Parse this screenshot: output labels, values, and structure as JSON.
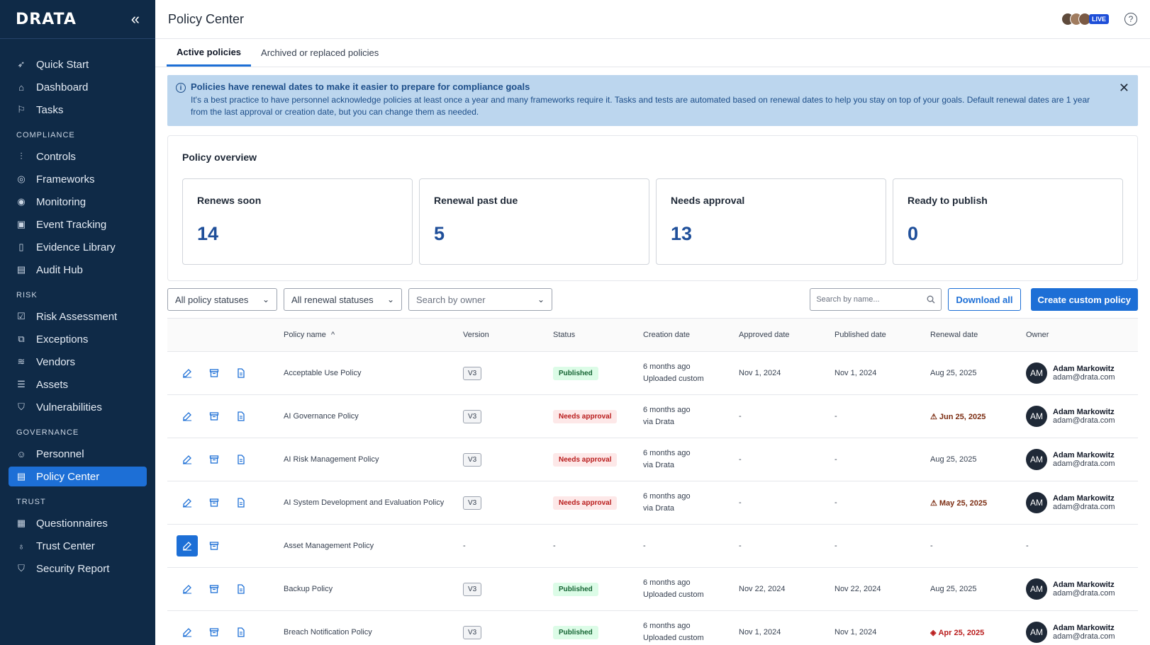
{
  "app": {
    "logo": "DRATA",
    "collapse_icon": "«"
  },
  "nav": {
    "top": [
      {
        "label": "Quick Start",
        "icon": "rocket-icon"
      },
      {
        "label": "Dashboard",
        "icon": "home-icon"
      },
      {
        "label": "Tasks",
        "icon": "flag-icon"
      }
    ],
    "sections": [
      {
        "title": "COMPLIANCE",
        "items": [
          {
            "label": "Controls"
          },
          {
            "label": "Frameworks"
          },
          {
            "label": "Monitoring"
          },
          {
            "label": "Event Tracking"
          },
          {
            "label": "Evidence Library"
          },
          {
            "label": "Audit Hub"
          }
        ]
      },
      {
        "title": "RISK",
        "items": [
          {
            "label": "Risk Assessment"
          },
          {
            "label": "Exceptions"
          },
          {
            "label": "Vendors"
          },
          {
            "label": "Assets"
          },
          {
            "label": "Vulnerabilities"
          }
        ]
      },
      {
        "title": "GOVERNANCE",
        "items": [
          {
            "label": "Personnel"
          },
          {
            "label": "Policy Center"
          }
        ]
      },
      {
        "title": "TRUST",
        "items": [
          {
            "label": "Questionnaires"
          },
          {
            "label": "Trust Center"
          },
          {
            "label": "Security Report"
          }
        ]
      }
    ]
  },
  "header": {
    "title": "Policy Center",
    "live": "LIVE",
    "help": "?"
  },
  "tabs": [
    {
      "label": "Active policies"
    },
    {
      "label": "Archived or replaced policies"
    }
  ],
  "banner": {
    "title": "Policies have renewal dates to make it easier to prepare for compliance goals",
    "body": "It's a best practice to have personnel acknowledge policies at least once a year and many frameworks require it. Tasks and tests are automated based on renewal dates to help you stay on top of your goals. Default renewal dates are 1 year from the last approval or creation date, but you can change them as needed.",
    "info": "i",
    "close": "✕"
  },
  "overview": {
    "title": "Policy overview",
    "cards": [
      {
        "label": "Renews soon",
        "value": "14"
      },
      {
        "label": "Renewal past due",
        "value": "5"
      },
      {
        "label": "Needs approval",
        "value": "13"
      },
      {
        "label": "Ready to publish",
        "value": "0"
      }
    ]
  },
  "filters": {
    "policy_status": "All policy statuses",
    "renewal_status": "All renewal statuses",
    "owner": "Search by owner",
    "search_placeholder": "Search by name...",
    "download": "Download all",
    "create": "Create custom policy",
    "chevron": "⌄"
  },
  "table": {
    "columns": {
      "name": "Policy name",
      "sort": "^",
      "version": "Version",
      "status": "Status",
      "created": "Creation date",
      "approved": "Approved date",
      "published": "Published date",
      "renewal": "Renewal date",
      "owner": "Owner"
    },
    "rows": [
      {
        "name": "Acceptable Use Policy",
        "version": "V3",
        "status": "Published",
        "created1": "6 months ago",
        "created2": "Uploaded custom",
        "approved": "Nov 1, 2024",
        "published": "Nov 1, 2024",
        "renewal": "Aug 25, 2025",
        "owner": "Adam Markowitz",
        "email": "adam@drata.com",
        "initials": "AM"
      },
      {
        "name": "AI Governance Policy",
        "version": "V3",
        "status": "Needs approval",
        "created1": "6 months ago",
        "created2": "via Drata",
        "approved": "-",
        "published": "-",
        "renewal": "Jun 25, 2025",
        "owner": "Adam Markowitz",
        "email": "adam@drata.com",
        "initials": "AM"
      },
      {
        "name": "AI Risk Management Policy",
        "version": "V3",
        "status": "Needs approval",
        "created1": "6 months ago",
        "created2": "via Drata",
        "approved": "-",
        "published": "-",
        "renewal": "Aug 25, 2025",
        "owner": "Adam Markowitz",
        "email": "adam@drata.com",
        "initials": "AM"
      },
      {
        "name": "AI System Development and Evaluation Policy",
        "version": "V3",
        "status": "Needs approval",
        "created1": "6 months ago",
        "created2": "via Drata",
        "approved": "-",
        "published": "-",
        "renewal": "May 25, 2025",
        "owner": "Adam Markowitz",
        "email": "adam@drata.com",
        "initials": "AM"
      },
      {
        "name": "Asset Management Policy",
        "version": "-",
        "status": "-",
        "created1": "-",
        "created2": "",
        "approved": "-",
        "published": "-",
        "renewal": "-",
        "owner": "-",
        "email": "",
        "initials": ""
      },
      {
        "name": "Backup Policy",
        "version": "V3",
        "status": "Published",
        "created1": "6 months ago",
        "created2": "Uploaded custom",
        "approved": "Nov 22, 2024",
        "published": "Nov 22, 2024",
        "renewal": "Aug 25, 2025",
        "owner": "Adam Markowitz",
        "email": "adam@drata.com",
        "initials": "AM"
      },
      {
        "name": "Breach Notification Policy",
        "version": "V3",
        "status": "Published",
        "created1": "6 months ago",
        "created2": "Uploaded custom",
        "approved": "Nov 1, 2024",
        "published": "Nov 1, 2024",
        "renewal": "Apr 25, 2025",
        "owner": "Adam Markowitz",
        "email": "adam@drata.com",
        "initials": "AM"
      }
    ]
  },
  "colors": {
    "sidebar": "#0f2a47",
    "accent": "#1d6fd6",
    "number": "#1f4f9a"
  }
}
